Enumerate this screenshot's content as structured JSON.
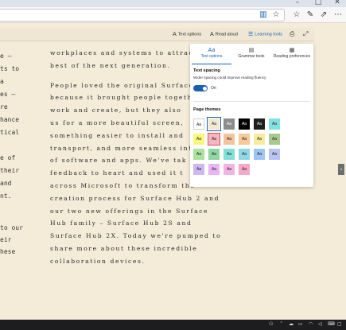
{
  "window": {
    "minimize": "–",
    "maximize": "□",
    "close": "✕"
  },
  "browser_toolbar": {
    "icons": [
      "reading-view-icon",
      "favorite-star-icon",
      "favorites-list-icon",
      "notes-icon",
      "share-icon",
      "more-icon"
    ]
  },
  "reader_toolbar": {
    "text_options": "Text options",
    "read_aloud": "Read aloud",
    "learning_tools": "Learning tools"
  },
  "left_fragments": [
    "e –",
    "ts to",
    "a",
    "es –",
    "re",
    "hance",
    "tical",
    "e of",
    "their",
    "and",
    "nt.",
    "to our",
    "eir",
    "hese"
  ],
  "article_lines": [
    "workplaces and systems to attrac",
    "best of the next generation.",
    "",
    "People loved the original Surface",
    "because it brought people togeth",
    "work and create, but they also",
    "us for a more beautiful screen,",
    "something easier to install and",
    "transport, and more seamless int",
    "of software and apps. We've tak",
    "feedback to heart and used it t",
    "across Microsoft to transform the",
    "creation process for Surface Hub 2 and",
    "our two new offerings in the Surface",
    "Hub family – Surface Hub 2S and",
    "Surface Hub 2X. Today we're pumped to",
    "share more about these incredible",
    "collaboration devices."
  ],
  "panel": {
    "tabs": [
      {
        "label": "Text options",
        "icon": "text-options-icon"
      },
      {
        "label": "Grammar tools",
        "icon": "grammar-tools-icon"
      },
      {
        "label": "Reading preferences",
        "icon": "reading-preferences-icon"
      }
    ],
    "text_spacing_title": "Text spacing",
    "text_spacing_desc": "Wider spacing could improve reading fluency",
    "toggle_label": "On",
    "page_themes_title": "Page themes",
    "swatch_label": "Aa",
    "swatch_rows": [
      [
        "#ffffff",
        "#f1e9d2",
        "#8c8c8c",
        "#000000",
        "#1e1e1e",
        "#7fe3e0"
      ],
      [
        "#f7f77a",
        "#f4b6c1",
        "#f3c39c",
        "#f6c89a",
        "#f7ec9d",
        "#a9c98f"
      ],
      [
        "#a8e29c",
        "#8fd6a0",
        "#7fe0d6",
        "#8ed8e6",
        "#9ec6f2",
        "#b9c4f2"
      ],
      [
        "#cdb8f2",
        "#e9b4f2",
        "#f2b4e6",
        "#f6a8c9"
      ]
    ],
    "swatch_text_colors": [
      [
        "#222222",
        "#222222",
        "#ffffff",
        "#ffffff",
        "#ffffff",
        "#222222"
      ],
      [
        "#222222",
        "#222222",
        "#222222",
        "#222222",
        "#222222",
        "#222222"
      ],
      [
        "#222222",
        "#222222",
        "#222222",
        "#222222",
        "#222222",
        "#222222"
      ],
      [
        "#222222",
        "#222222",
        "#222222",
        "#222222"
      ]
    ]
  },
  "accent_color": "#1a5fb4",
  "page_background": "#f4ecd8"
}
